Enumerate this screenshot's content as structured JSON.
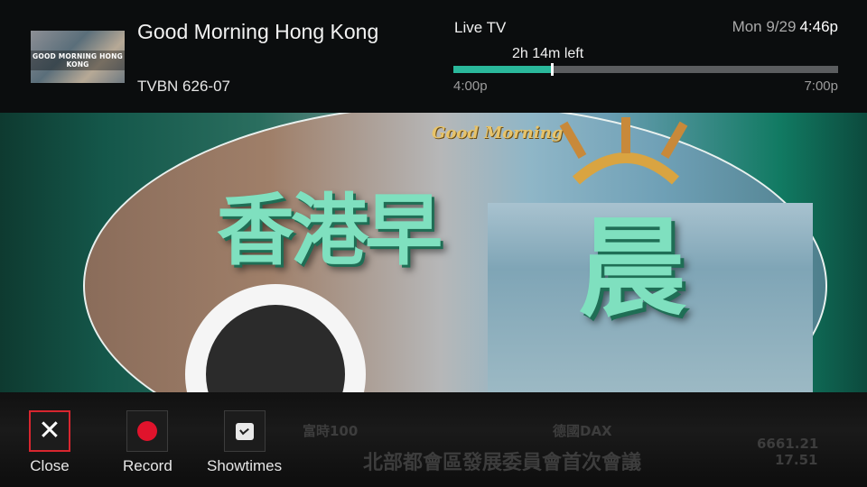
{
  "program": {
    "thumbnail_text": "GOOD MORNING HONG KONG",
    "title": "Good Morning Hong Kong",
    "channel": "TVBN 626-07"
  },
  "status": {
    "mode": "Live TV",
    "date": "Mon 9/29",
    "time": "4:46p",
    "remaining": "2h 14m left",
    "start": "4:00p",
    "end": "7:00p",
    "progress_fraction": 0.256
  },
  "video": {
    "logo_small": "Good Morning",
    "logo_main": "香港早",
    "logo_big": "晨"
  },
  "ticker": {
    "line1": [
      "富時100",
      "德國DAX"
    ],
    "line2": [
      "北部都會區發展委員會首次會議"
    ],
    "numbers": [
      "6661.21",
      "17.51"
    ]
  },
  "controls": {
    "close_label": "Close",
    "record_label": "Record",
    "showtimes_label": "Showtimes"
  },
  "colors": {
    "accent": "#2ab89b",
    "focus": "#d8262f",
    "record": "#e0132c"
  }
}
